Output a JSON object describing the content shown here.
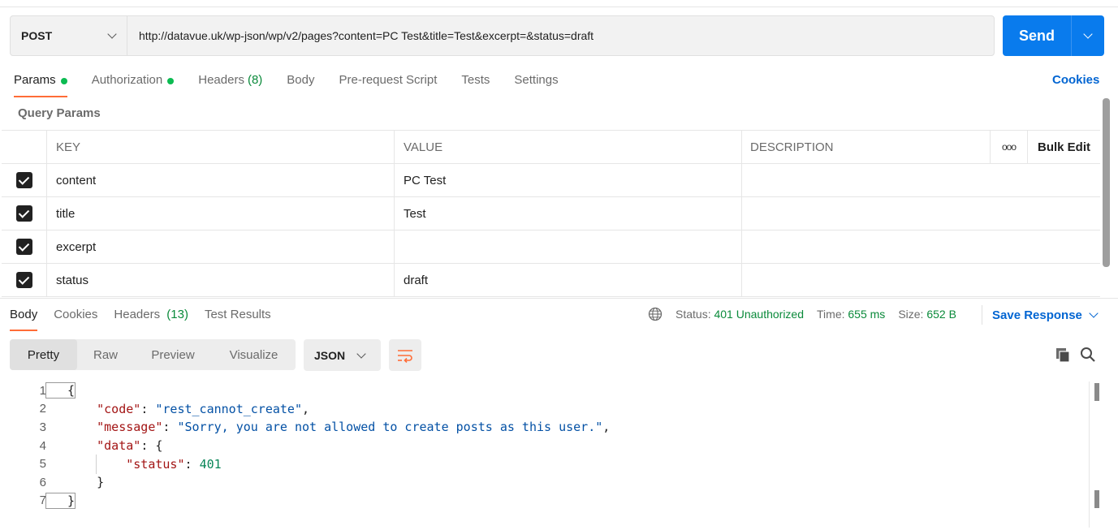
{
  "request": {
    "method": "POST",
    "url": "http://datavue.uk/wp-json/wp/v2/pages?content=PC Test&title=Test&excerpt=&status=draft",
    "send_label": "Send"
  },
  "request_tabs": [
    {
      "label": "Params",
      "dot": true,
      "active": true
    },
    {
      "label": "Authorization",
      "dot": true
    },
    {
      "label": "Headers",
      "count": "(8)"
    },
    {
      "label": "Body"
    },
    {
      "label": "Pre-request Script"
    },
    {
      "label": "Tests"
    },
    {
      "label": "Settings"
    }
  ],
  "cookies_label": "Cookies",
  "query_params": {
    "title": "Query Params",
    "headers": {
      "key": "KEY",
      "value": "VALUE",
      "description": "DESCRIPTION",
      "more": "ooo",
      "bulk_edit": "Bulk Edit"
    },
    "rows": [
      {
        "checked": true,
        "key": "content",
        "value": "PC Test",
        "description": ""
      },
      {
        "checked": true,
        "key": "title",
        "value": "Test",
        "description": ""
      },
      {
        "checked": true,
        "key": "excerpt",
        "value": "",
        "description": ""
      },
      {
        "checked": true,
        "key": "status",
        "value": "draft",
        "description": ""
      }
    ]
  },
  "response_tabs": [
    {
      "label": "Body",
      "active": true
    },
    {
      "label": "Cookies"
    },
    {
      "label": "Headers",
      "count": "(13)"
    },
    {
      "label": "Test Results"
    }
  ],
  "response_meta": {
    "status_label": "Status:",
    "status_value": "401 Unauthorized",
    "time_label": "Time:",
    "time_value": "655 ms",
    "size_label": "Size:",
    "size_value": "652 B",
    "save_label": "Save Response"
  },
  "views": [
    "Pretty",
    "Raw",
    "Preview",
    "Visualize"
  ],
  "format": "JSON",
  "code_lines": [
    {
      "n": "1",
      "text": "{"
    },
    {
      "n": "2",
      "text": "    \"code\": \"rest_cannot_create\","
    },
    {
      "n": "3",
      "text": "    \"message\": \"Sorry, you are not allowed to create posts as this user.\","
    },
    {
      "n": "4",
      "text": "    \"data\": {"
    },
    {
      "n": "5",
      "text": "        \"status\": 401"
    },
    {
      "n": "6",
      "text": "    }"
    },
    {
      "n": "7",
      "text": "}"
    }
  ],
  "colors": {
    "accent": "#ff6c37",
    "send": "#097bed",
    "link": "#0265d2",
    "success": "#0a8a3a"
  }
}
